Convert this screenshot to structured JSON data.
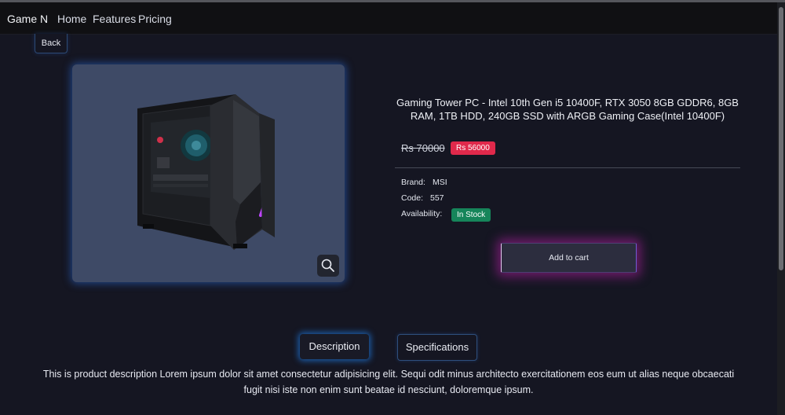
{
  "navbar": {
    "brand": "Game N",
    "links": [
      "Home",
      "Features",
      "Pricing"
    ]
  },
  "back_label": "Back",
  "product": {
    "title": "Gaming Tower PC - Intel 10th Gen i5 10400F, RTX 3050 8GB GDDR6, 8GB RAM, 1TB HDD, 240GB SSD with ARGB Gaming Case(Intel 10400F)",
    "old_price": "Rs 70000",
    "new_price": "Rs 56000",
    "brand_label": "Brand:",
    "brand_value": "MSI",
    "code_label": "Code:",
    "code_value": "557",
    "availability_label": "Availability:",
    "availability_value": "In Stock",
    "add_to_cart": "Add to cart"
  },
  "tabs": {
    "description": "Description",
    "specifications": "Specifications"
  },
  "description_text": "This is product description Lorem ipsum dolor sit amet consectetur adipisicing elit. Sequi odit minus architecto exercitationem eos eum ut alias neque obcaecati fugit nisi iste non enim sunt beatae id nesciunt, doloremque ipsum.",
  "icons": {
    "zoom": "magnifier-icon",
    "product_image": "gaming-pc-case"
  },
  "colors": {
    "page_bg": "#151622",
    "sale_badge": "#e0294b",
    "stock_badge": "#16855a",
    "glow_blue": "#1f78dc",
    "glow_magenta": "#b920aa"
  }
}
